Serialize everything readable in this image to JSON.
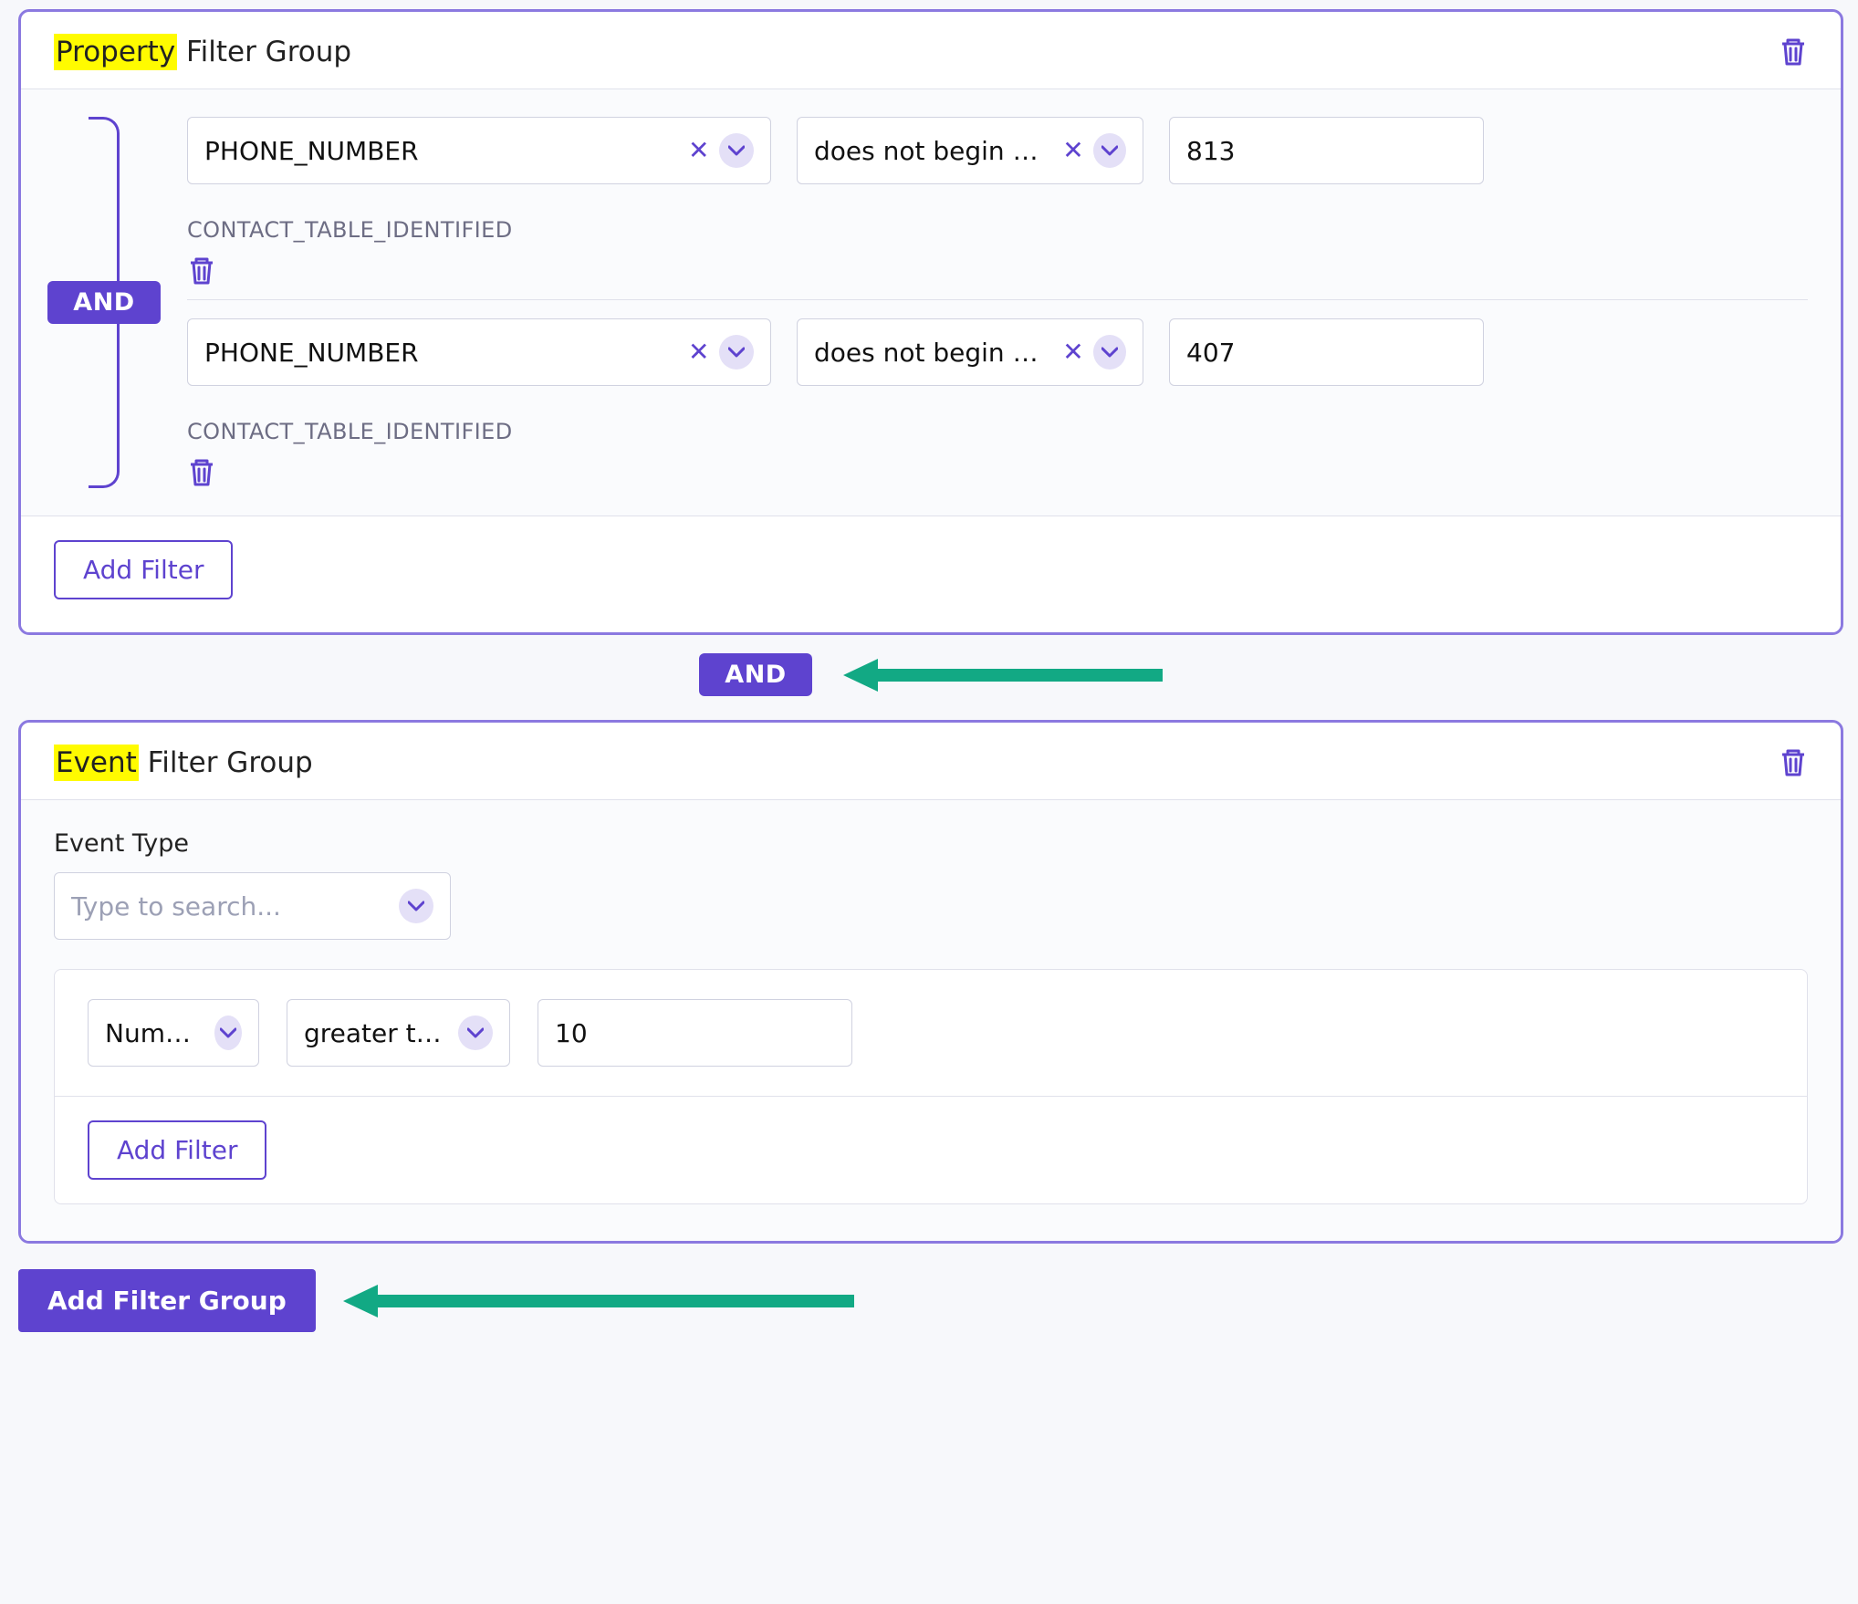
{
  "group1": {
    "title_hl": "Property",
    "title_rest": " Filter Group",
    "inner_and": "AND",
    "filter1": {
      "field": "PHONE_NUMBER",
      "op": "does not begin with",
      "value": "813",
      "source": "CONTACT_TABLE_IDENTIFIED"
    },
    "filter2": {
      "field": "PHONE_NUMBER",
      "op": "does not begin with",
      "value": "407",
      "source": "CONTACT_TABLE_IDENTIFIED"
    },
    "add_filter": "Add Filter"
  },
  "between_and": "AND",
  "group2": {
    "title_hl": "Event",
    "title_rest": " Filter Group",
    "event_type_label": "Event Type",
    "search_placeholder": "Type to search...",
    "metric": "Number c",
    "comparator": "greater tha",
    "value": "10",
    "add_filter": "Add Filter"
  },
  "add_group": "Add Filter Group"
}
